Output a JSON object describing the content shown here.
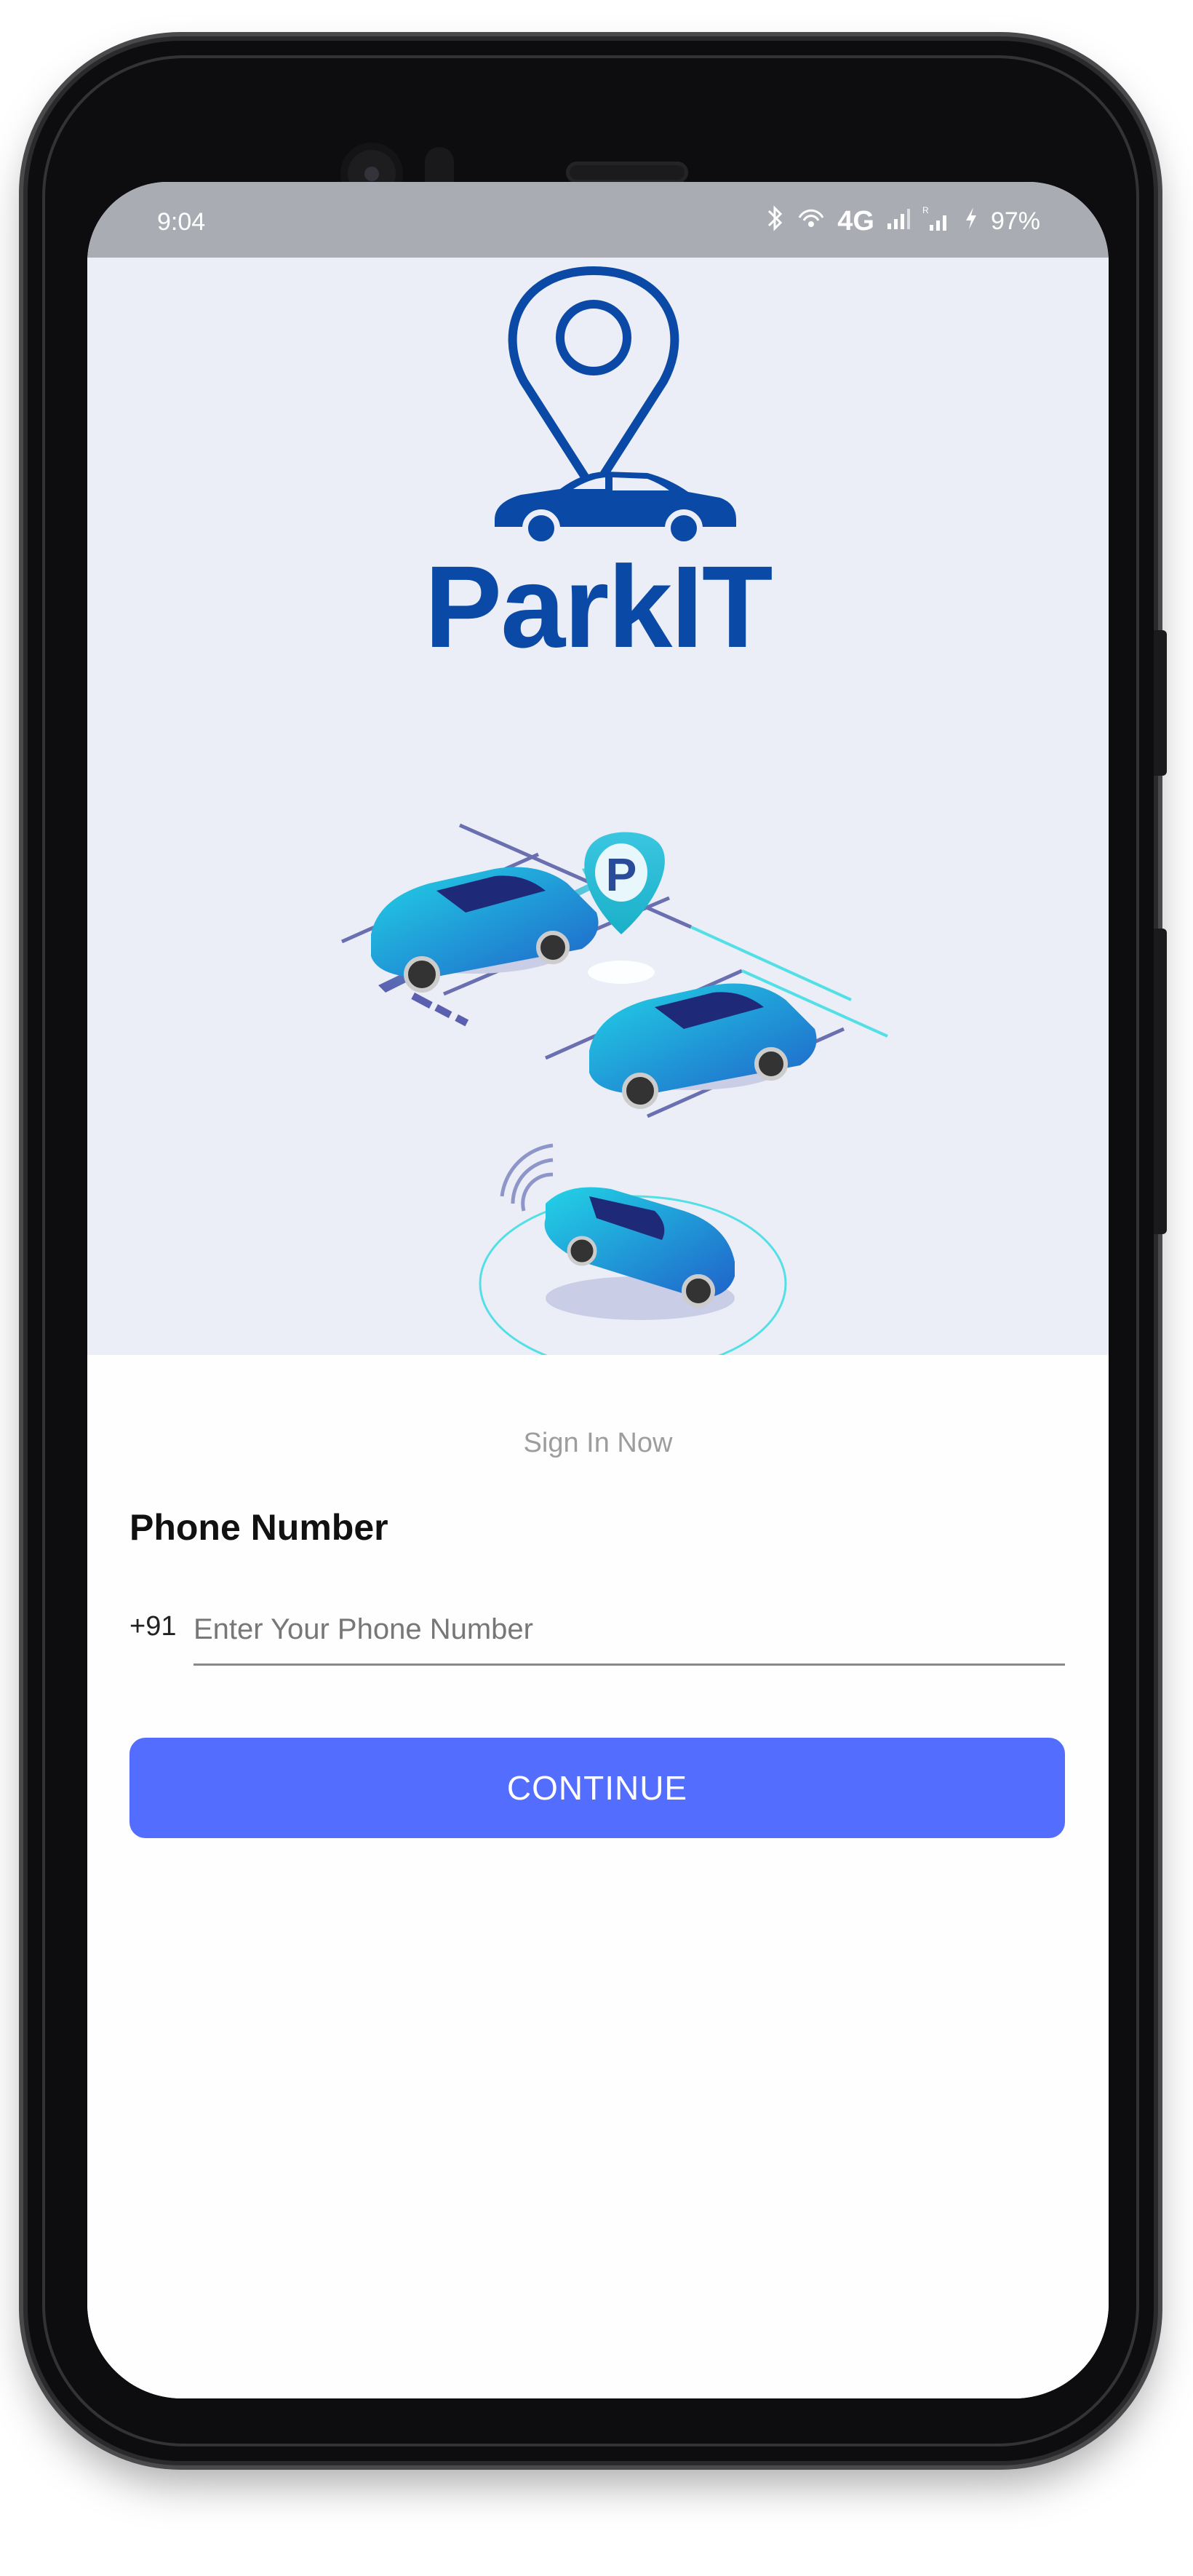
{
  "status_bar": {
    "time": "9:04",
    "network": "4G",
    "battery": "97%",
    "icons": [
      "bluetooth-icon",
      "hotspot-icon",
      "signal-icon",
      "roaming-signal-icon",
      "charging-icon"
    ]
  },
  "logo": {
    "text": "ParkIT",
    "brand_color": "#0a4aa6"
  },
  "form": {
    "subtitle": "Sign In Now",
    "phone_label": "Phone Number",
    "country_code": "+91",
    "phone_value": "",
    "phone_placeholder": "Enter Your Phone Number",
    "continue_label": "CONTINUE",
    "accent_color": "#536dfe"
  }
}
